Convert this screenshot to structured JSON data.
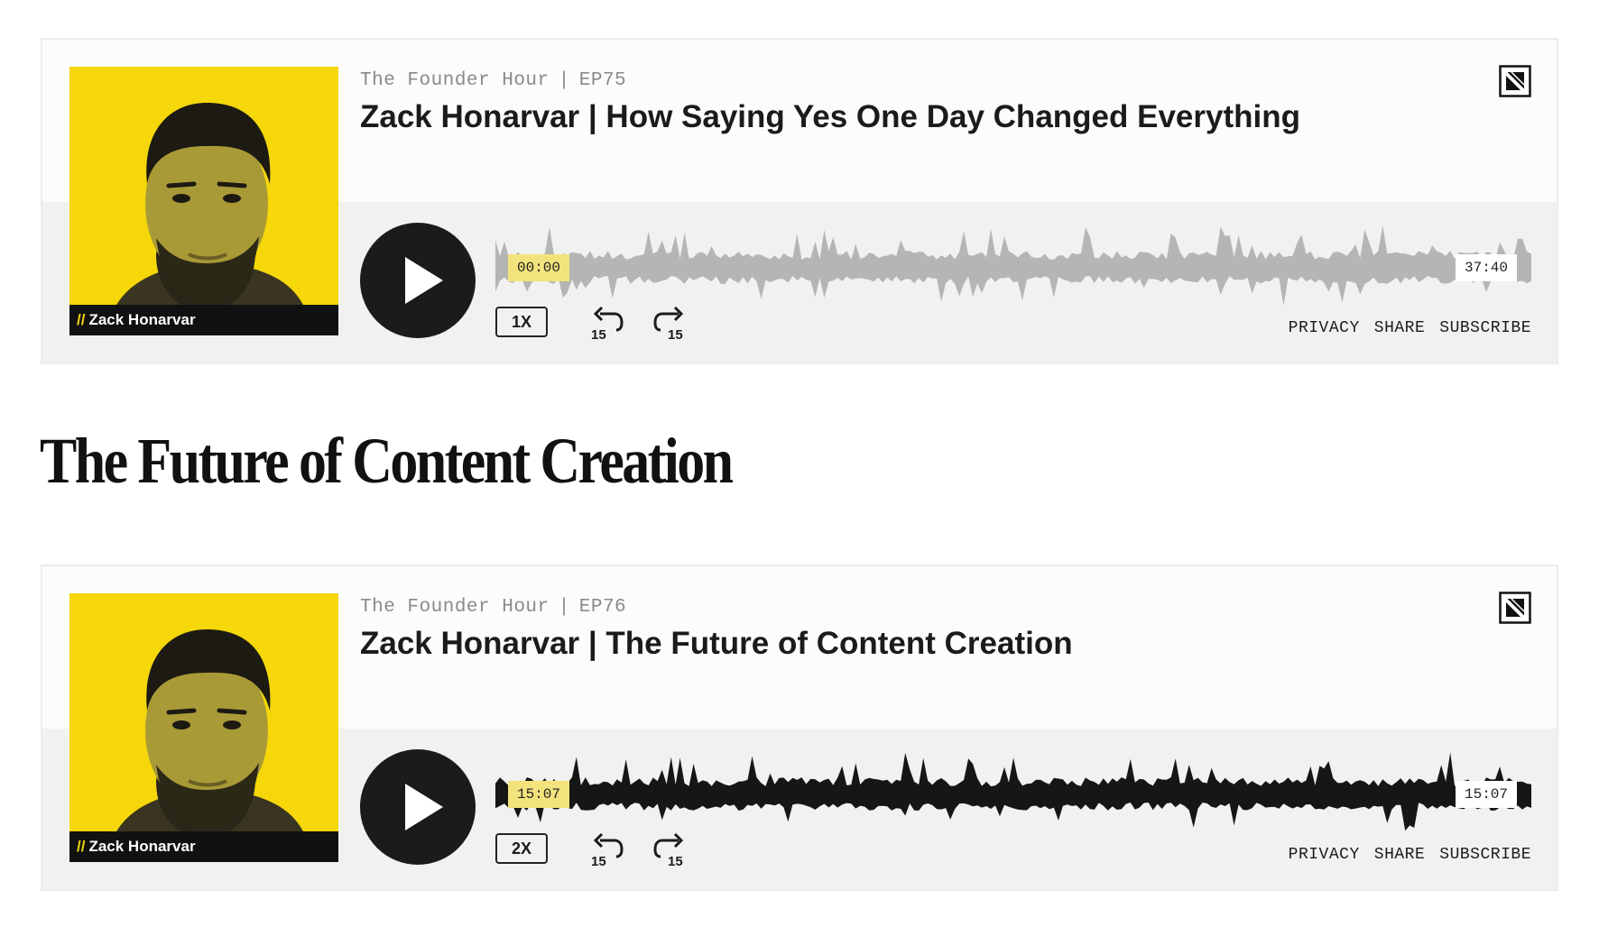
{
  "players": [
    {
      "cover_name": "Zack Honarvar",
      "cover_slashes": "//",
      "show": "The Founder Hour",
      "separator": "|",
      "episode": "EP75",
      "title": "Zack Honarvar | How Saying Yes One Day Changed Everything",
      "current_time": "00:00",
      "duration": "37:40",
      "progress": 0,
      "speed": "1X",
      "skip_back": "15",
      "skip_forward": "15",
      "wave_color": "#b5b5b5",
      "links": {
        "privacy": "PRIVACY",
        "share": "SHARE",
        "subscribe": "SUBSCRIBE"
      }
    },
    {
      "cover_name": "Zack Honarvar",
      "cover_slashes": "//",
      "show": "The Founder Hour",
      "separator": "|",
      "episode": "EP76",
      "title": "Zack Honarvar | The Future of Content Creation",
      "current_time": "15:07",
      "duration": "15:07",
      "progress": 1,
      "speed": "2X",
      "skip_back": "15",
      "skip_forward": "15",
      "wave_color": "#161616",
      "links": {
        "privacy": "PRIVACY",
        "share": "SHARE",
        "subscribe": "SUBSCRIBE"
      }
    }
  ],
  "section_heading": "The Future of Content Creation",
  "colors": {
    "cover_bg": "#f5d70a",
    "time_badge": "#f3e37c",
    "button_dark": "#1b1b1b"
  },
  "icons": [
    "brand-icon",
    "play-icon",
    "rewind-15-icon",
    "forward-15-icon"
  ]
}
